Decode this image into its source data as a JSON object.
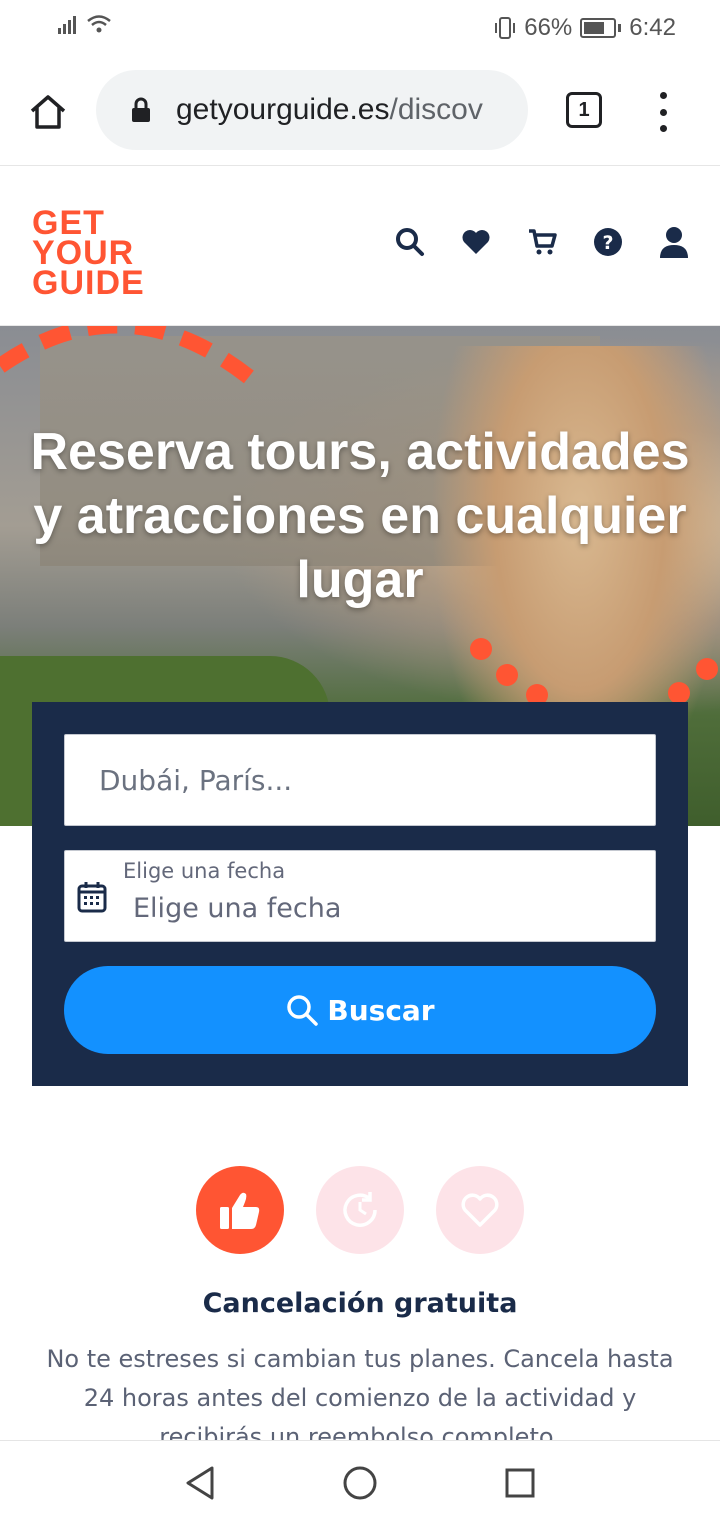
{
  "status_bar": {
    "battery_percent": "66%",
    "time": "6:42"
  },
  "browser": {
    "url_domain": "getyourguide.es",
    "url_path": "/discov",
    "tab_count": "1"
  },
  "site": {
    "logo_lines": [
      "GET",
      "YOUR",
      "GUIDE"
    ],
    "header_icons": [
      "search-icon",
      "heart-icon",
      "cart-icon",
      "help-icon",
      "user-icon"
    ]
  },
  "hero": {
    "title": "Reserva tours, actividades y atracciones en cualquier lugar"
  },
  "search": {
    "destination_placeholder": "Dubái, París...",
    "date_label": "Elige una fecha",
    "date_placeholder": "Elige una fecha",
    "button_label": "Buscar"
  },
  "features": {
    "title": "Cancelación gratuita",
    "description": "No te estreses si cambian tus planes. Cancela hasta 24 horas antes del comienzo de la actividad y recibirás un reembolso completo."
  },
  "colors": {
    "brand_orange": "#ff5533",
    "navy": "#1a2b49",
    "button_blue": "#1391ff",
    "inactive_pink": "#fde3e8"
  }
}
